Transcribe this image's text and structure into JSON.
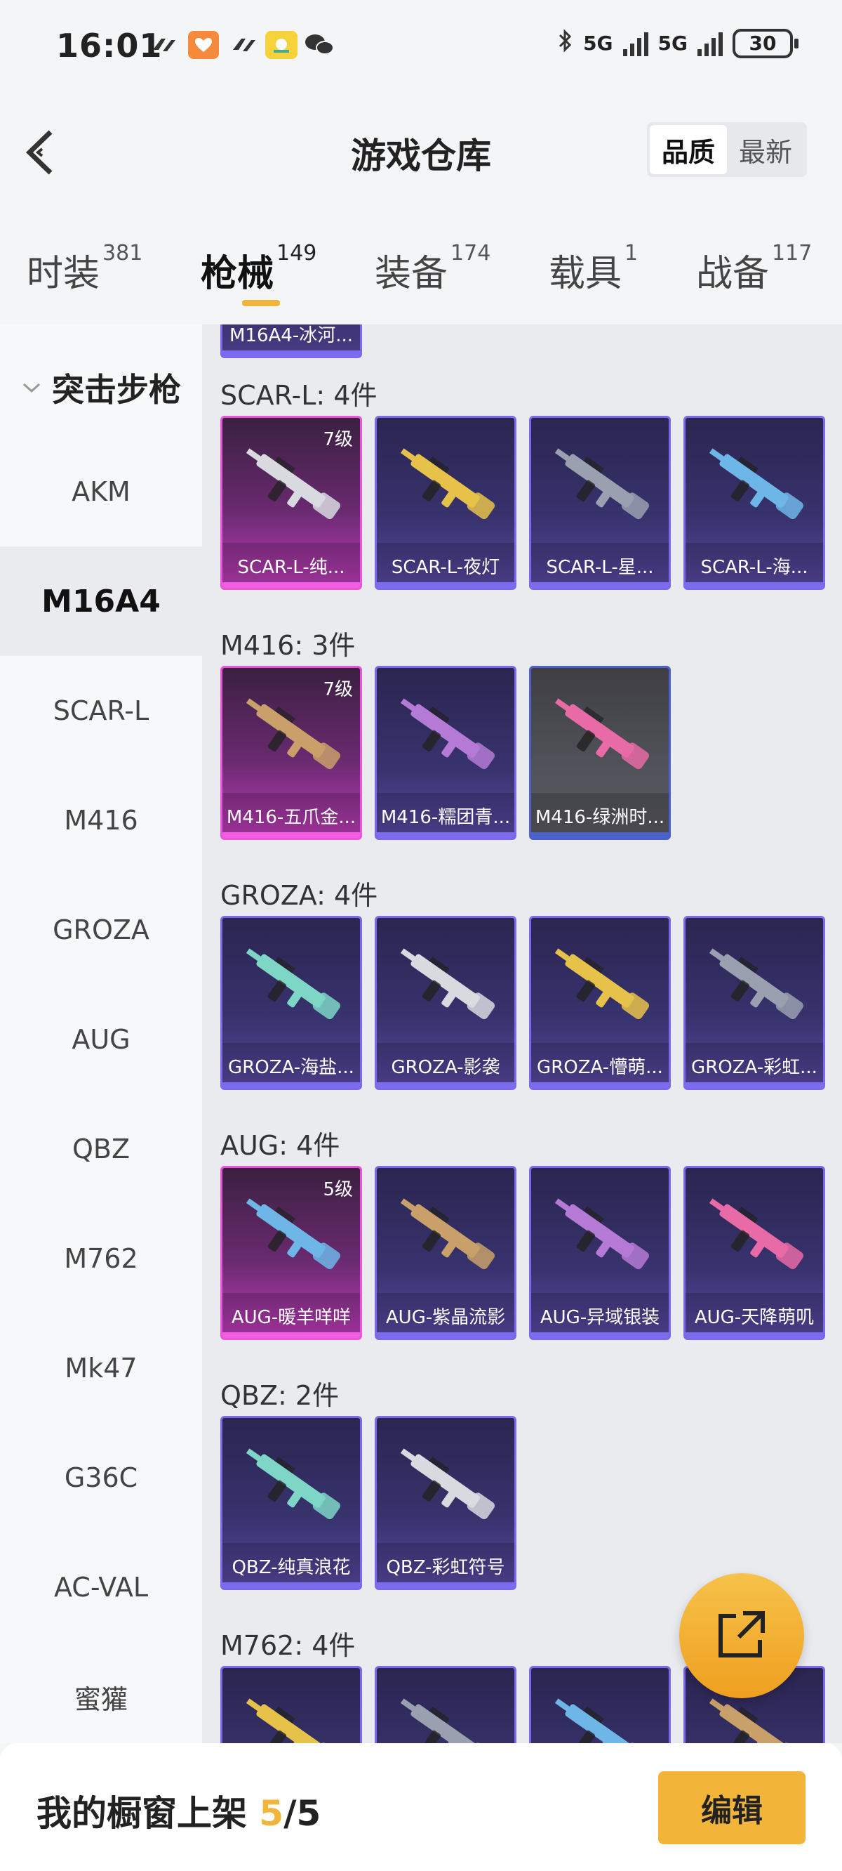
{
  "status_bar": {
    "time": "16:01",
    "network1": "5G",
    "network2": "5G",
    "battery": "30"
  },
  "header": {
    "back_icon": "back-chevron-icon",
    "title": "游戏仓库",
    "sort_options": [
      "品质",
      "最新"
    ],
    "sort_selected": "品质"
  },
  "tabs": [
    {
      "label": "时装",
      "count": "381"
    },
    {
      "label": "枪械",
      "count": "149",
      "active": true
    },
    {
      "label": "装备",
      "count": "174"
    },
    {
      "label": "载具",
      "count": "1"
    },
    {
      "label": "战备",
      "count": "117"
    }
  ],
  "sidebar": {
    "category": "突击步枪",
    "items": [
      "AKM",
      "M16A4",
      "SCAR-L",
      "M416",
      "GROZA",
      "AUG",
      "QBZ",
      "M762",
      "Mk47",
      "G36C",
      "AC-VAL",
      "蜜獾"
    ],
    "active": "M16A4"
  },
  "main": {
    "partial_top_label": "M16A4-冰河...",
    "groups": [
      {
        "title": "SCAR-L: 4件",
        "items": [
          {
            "name": "SCAR-L-纯...",
            "grade": "7级",
            "style": "pink"
          },
          {
            "name": "SCAR-L-夜灯",
            "grade": "",
            "style": "purple"
          },
          {
            "name": "SCAR-L-星...",
            "grade": "",
            "style": "purple"
          },
          {
            "name": "SCAR-L-海...",
            "grade": "",
            "style": "purple"
          }
        ]
      },
      {
        "title": "M416: 3件",
        "items": [
          {
            "name": "M416-五爪金...",
            "grade": "7级",
            "style": "pink"
          },
          {
            "name": "M416-糯团青...",
            "grade": "",
            "style": "purple"
          },
          {
            "name": "M416-绿洲时...",
            "grade": "",
            "style": "gray"
          }
        ]
      },
      {
        "title": "GROZA: 4件",
        "items": [
          {
            "name": "GROZA-海盐...",
            "grade": "",
            "style": "purple"
          },
          {
            "name": "GROZA-影袭",
            "grade": "",
            "style": "purple"
          },
          {
            "name": "GROZA-懵萌...",
            "grade": "",
            "style": "purple"
          },
          {
            "name": "GROZA-彩虹...",
            "grade": "",
            "style": "purple"
          }
        ]
      },
      {
        "title": "AUG: 4件",
        "items": [
          {
            "name": "AUG-暖羊咩咩",
            "grade": "5级",
            "style": "pink"
          },
          {
            "name": "AUG-紫晶流影",
            "grade": "",
            "style": "purple"
          },
          {
            "name": "AUG-异域银装",
            "grade": "",
            "style": "purple"
          },
          {
            "name": "AUG-天降萌叽",
            "grade": "",
            "style": "purple"
          }
        ]
      },
      {
        "title": "QBZ: 2件",
        "items": [
          {
            "name": "QBZ-纯真浪花",
            "grade": "",
            "style": "purple"
          },
          {
            "name": "QBZ-彩虹符号",
            "grade": "",
            "style": "purple"
          }
        ]
      },
      {
        "title": "M762: 4件",
        "items": [
          {
            "name": "",
            "grade": "",
            "style": "purple"
          },
          {
            "name": "",
            "grade": "",
            "style": "purple"
          },
          {
            "name": "",
            "grade": "",
            "style": "purple"
          },
          {
            "name": "",
            "grade": "",
            "style": "purple"
          }
        ]
      }
    ]
  },
  "fab": {
    "icon": "share-external-icon"
  },
  "bottom_bar": {
    "label": "我的橱窗上架",
    "current": "5",
    "separator": "/",
    "total": "5",
    "edit_label": "编辑"
  },
  "colors": {
    "accent": "#f0b63c",
    "pink_border": "#e855d8",
    "purple_border": "#7c68e8"
  }
}
